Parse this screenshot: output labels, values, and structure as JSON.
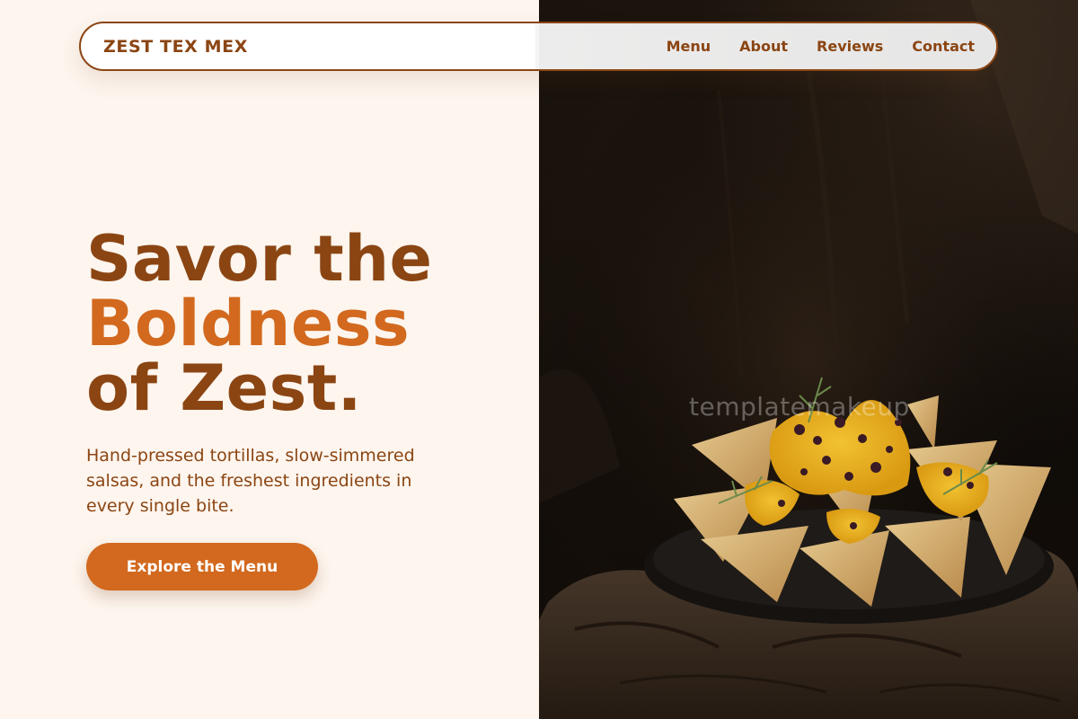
{
  "navbar": {
    "brand": "ZEST TEX MEX",
    "links": [
      "Menu",
      "About",
      "Reviews",
      "Contact"
    ]
  },
  "hero": {
    "title_line1": "Savor the",
    "title_line2": "Boldness",
    "title_line3": "of Zest.",
    "subtitle": "Hand-pressed tortillas, slow-simmered salsas, and the freshest ingredients in every single bite.",
    "cta_label": "Explore the Menu"
  },
  "photo": {
    "watermark": "templatemakeup",
    "subject": "nachos-platter-photo"
  },
  "colors": {
    "background": "#fdf5ee",
    "brand_brown": "#8b4513",
    "accent_orange": "#d2691e"
  }
}
